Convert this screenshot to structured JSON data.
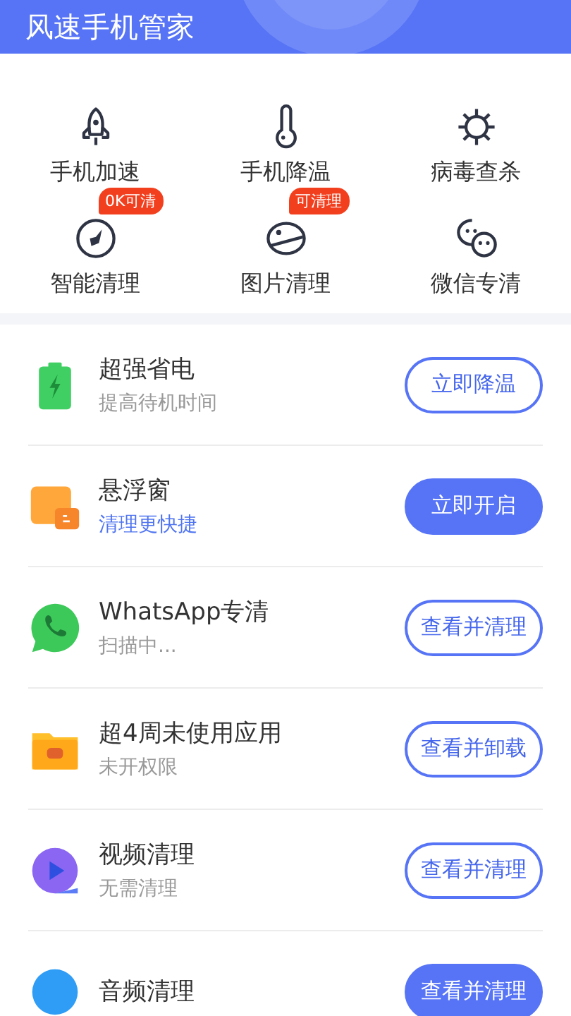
{
  "header": {
    "title": "风速手机管家"
  },
  "tools": [
    {
      "label": "手机加速"
    },
    {
      "label": "手机降温"
    },
    {
      "label": "病毒查杀"
    },
    {
      "label": "智能清理",
      "badge": "0K可清"
    },
    {
      "label": "图片清理",
      "badge": "可清理"
    },
    {
      "label": "微信专清"
    }
  ],
  "features": [
    {
      "title": "超强省电",
      "subtitle": "提高待机时间",
      "subtitle_highlight": false,
      "button": "立即降温",
      "button_filled": false
    },
    {
      "title": "悬浮窗",
      "subtitle": "清理更快捷",
      "subtitle_highlight": true,
      "button": "立即开启",
      "button_filled": true
    },
    {
      "title": "WhatsApp专清",
      "subtitle": "扫描中...",
      "subtitle_highlight": false,
      "button": "查看并清理",
      "button_filled": false
    },
    {
      "title": "超4周未使用应用",
      "subtitle": "未开权限",
      "subtitle_highlight": false,
      "button": "查看并卸载",
      "button_filled": false
    },
    {
      "title": "视频清理",
      "subtitle": "无需清理",
      "subtitle_highlight": false,
      "button": "查看并清理",
      "button_filled": false
    },
    {
      "title": "音频清理",
      "button": "查看并清理",
      "button_filled": true
    }
  ]
}
